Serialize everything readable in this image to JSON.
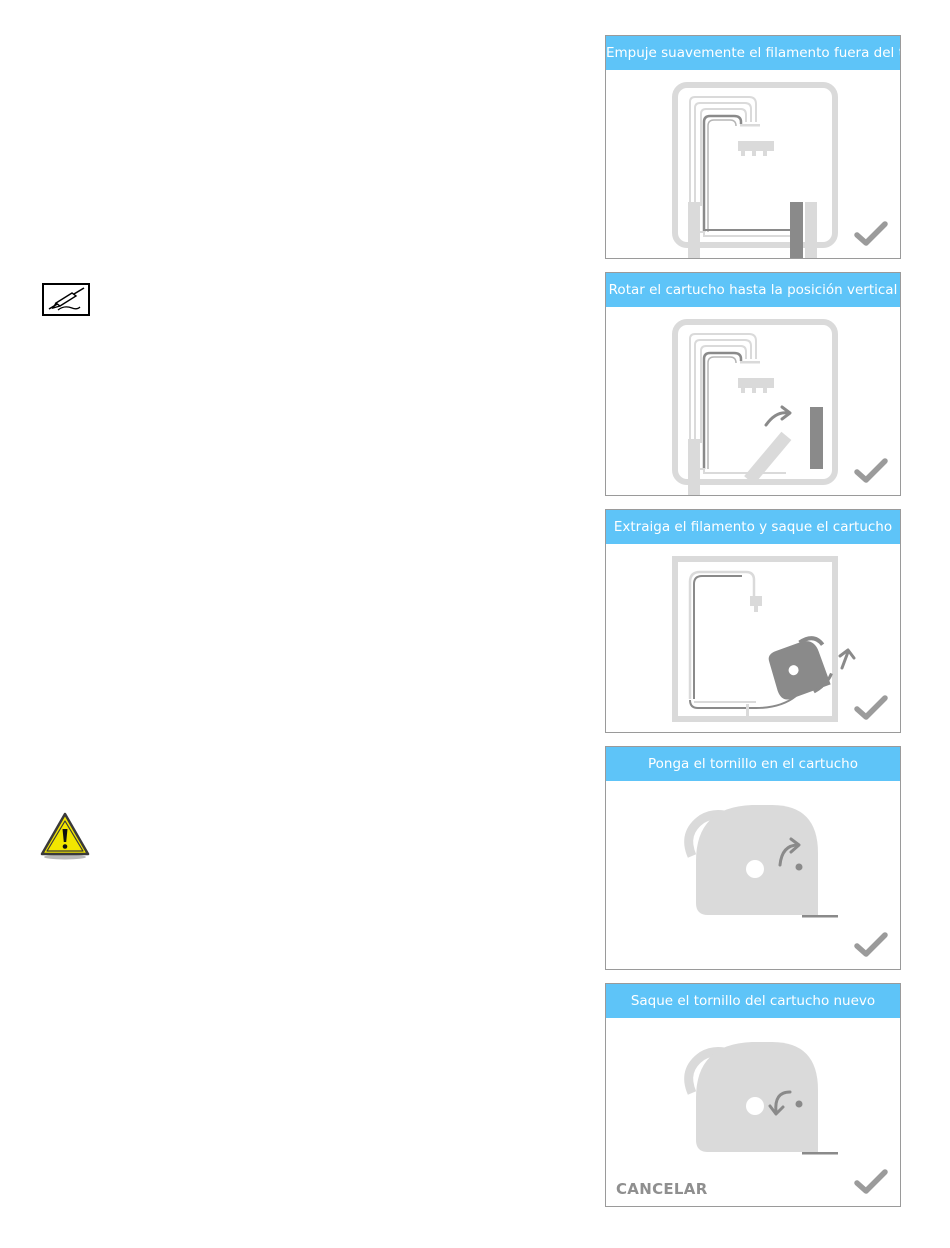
{
  "panels": [
    {
      "title": "Empuje suavemente el filamento fuera del tubo",
      "confirm_icon": "check-icon"
    },
    {
      "title": "Rotar el cartucho hasta la posición vertical",
      "confirm_icon": "check-icon"
    },
    {
      "title": "Extraiga el filamento y saque el cartucho",
      "confirm_icon": "check-icon"
    },
    {
      "title": "Ponga el tornillo en el cartucho",
      "confirm_icon": "check-icon"
    },
    {
      "title": "Saque el tornillo del cartucho nuevo",
      "confirm_icon": "check-icon",
      "cancel_label": "CANCELAR"
    }
  ],
  "icons": {
    "note": "note-pencil-icon",
    "warning": "warning-triangle-icon"
  },
  "colors": {
    "header": "#5ec4f8",
    "illustration_light": "#dadada",
    "illustration_dark": "#8a8a8a",
    "check": "#9b9b9b"
  }
}
